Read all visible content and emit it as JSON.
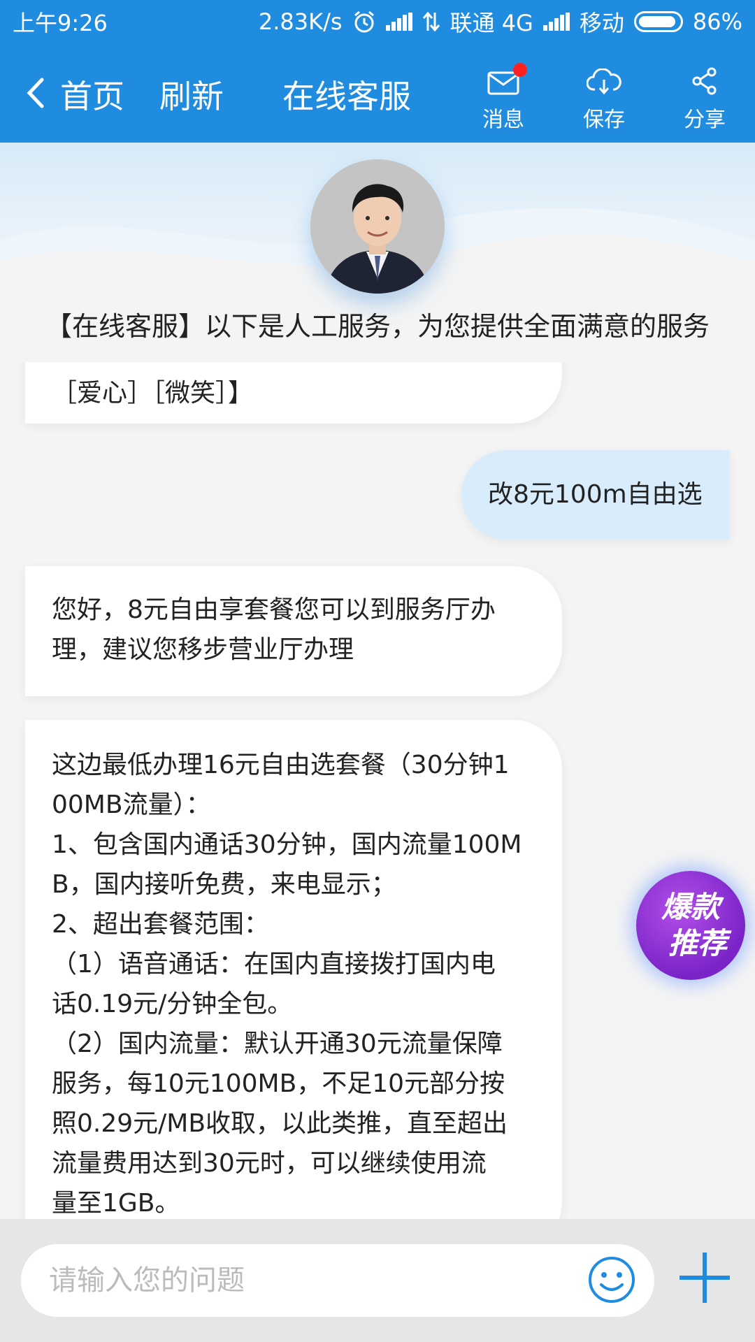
{
  "status_bar": {
    "time": "上午9:26",
    "speed": "2.83K/s",
    "carrier1": "联通 4G",
    "carrier2": "移动",
    "battery": "86%"
  },
  "nav": {
    "home": "首页",
    "refresh": "刷新",
    "title": "在线客服",
    "message": "消息",
    "save": "保存",
    "share": "分享"
  },
  "notice": "【在线客服】以下是人工服务，为您提供全面满意的服务",
  "messages": [
    {
      "side": "left",
      "lines": [
        "［爱心］［微笑］】"
      ]
    },
    {
      "side": "right",
      "lines": [
        "改8元100m自由选"
      ]
    },
    {
      "side": "left",
      "lines": [
        "您好，8元自由享套餐您可以到服务厅办",
        "理，建议您移步营业厅办理"
      ]
    },
    {
      "side": "left",
      "lines": [
        "这边最低办理16元自由选套餐（30分钟1",
        "00MB流量）：",
        "1、包含国内通话30分钟，国内流量100M",
        "B，国内接听免费，来电显示；",
        "2、超出套餐范围：",
        "（1）语音通话：在国内直接拨打国内电",
        "话0.19元/分钟全包。",
        "（2）国内流量：默认开通30元流量保障",
        "服务，每10元100MB，不足10元部分按",
        "照0.29元/MB收取，以此类推，直至超出",
        "流量费用达到30元时，可以继续使用流",
        "量至1GB。"
      ]
    }
  ],
  "float_button": {
    "line1": "爆款",
    "line2": "推荐"
  },
  "input": {
    "placeholder": "请输入您的问题",
    "value": ""
  },
  "icons": [
    "back-icon",
    "mail-icon",
    "cloud-download-icon",
    "share-icon",
    "emoji-icon",
    "plus-icon"
  ],
  "colors": {
    "header": "#1f8ce0",
    "badge": "#ff2020",
    "user_bubble": "#d8ecfc",
    "plus": "#1f8ce0"
  }
}
